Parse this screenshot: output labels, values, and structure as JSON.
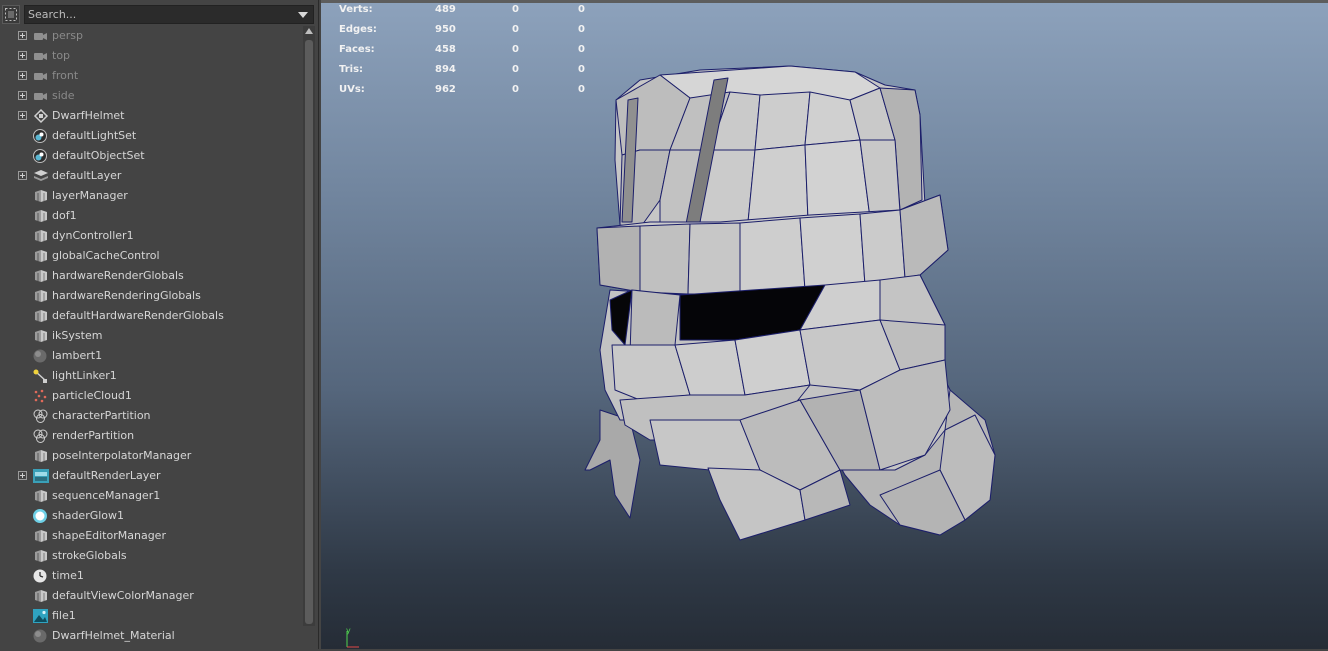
{
  "outliner": {
    "search_placeholder": "Search...",
    "items": [
      {
        "label": "persp",
        "icon": "camera-icon",
        "expandable": true,
        "dim": true
      },
      {
        "label": "top",
        "icon": "camera-icon",
        "expandable": true,
        "dim": true
      },
      {
        "label": "front",
        "icon": "camera-icon",
        "expandable": true,
        "dim": true
      },
      {
        "label": "side",
        "icon": "camera-icon",
        "expandable": true,
        "dim": true
      },
      {
        "label": "DwarfHelmet",
        "icon": "group-icon",
        "expandable": true,
        "dim": false
      },
      {
        "label": "defaultLightSet",
        "icon": "set-icon",
        "expandable": false,
        "dim": false
      },
      {
        "label": "defaultObjectSet",
        "icon": "set-icon",
        "expandable": false,
        "dim": false
      },
      {
        "label": "defaultLayer",
        "icon": "layer-icon",
        "expandable": true,
        "dim": false
      },
      {
        "label": "layerManager",
        "icon": "node-icon",
        "expandable": false,
        "dim": false
      },
      {
        "label": "dof1",
        "icon": "node-icon",
        "expandable": false,
        "dim": false
      },
      {
        "label": "dynController1",
        "icon": "node-icon",
        "expandable": false,
        "dim": false
      },
      {
        "label": "globalCacheControl",
        "icon": "node-icon",
        "expandable": false,
        "dim": false
      },
      {
        "label": "hardwareRenderGlobals",
        "icon": "node-icon",
        "expandable": false,
        "dim": false
      },
      {
        "label": "hardwareRenderingGlobals",
        "icon": "node-icon",
        "expandable": false,
        "dim": false
      },
      {
        "label": "defaultHardwareRenderGlobals",
        "icon": "node-icon",
        "expandable": false,
        "dim": false
      },
      {
        "label": "ikSystem",
        "icon": "node-icon",
        "expandable": false,
        "dim": false
      },
      {
        "label": "lambert1",
        "icon": "material-sphere-icon",
        "expandable": false,
        "dim": false
      },
      {
        "label": "lightLinker1",
        "icon": "light-linker-icon",
        "expandable": false,
        "dim": false
      },
      {
        "label": "particleCloud1",
        "icon": "particle-icon",
        "expandable": false,
        "dim": false
      },
      {
        "label": "characterPartition",
        "icon": "partition-icon",
        "expandable": false,
        "dim": false
      },
      {
        "label": "renderPartition",
        "icon": "partition-icon",
        "expandable": false,
        "dim": false
      },
      {
        "label": "poseInterpolatorManager",
        "icon": "node-icon",
        "expandable": false,
        "dim": false
      },
      {
        "label": "defaultRenderLayer",
        "icon": "render-layer-icon",
        "expandable": true,
        "dim": false
      },
      {
        "label": "sequenceManager1",
        "icon": "node-icon",
        "expandable": false,
        "dim": false
      },
      {
        "label": "shaderGlow1",
        "icon": "shader-glow-icon",
        "expandable": false,
        "dim": false
      },
      {
        "label": "shapeEditorManager",
        "icon": "node-icon",
        "expandable": false,
        "dim": false
      },
      {
        "label": "strokeGlobals",
        "icon": "node-icon",
        "expandable": false,
        "dim": false
      },
      {
        "label": "time1",
        "icon": "clock-icon",
        "expandable": false,
        "dim": false
      },
      {
        "label": "defaultViewColorManager",
        "icon": "node-icon",
        "expandable": false,
        "dim": false
      },
      {
        "label": "file1",
        "icon": "image-file-icon",
        "expandable": false,
        "dim": false
      },
      {
        "label": "DwarfHelmet_Material",
        "icon": "material-sphere-icon",
        "expandable": false,
        "dim": false
      }
    ]
  },
  "viewport": {
    "hud": [
      {
        "label": "Verts:",
        "v1": "489",
        "v2": "0",
        "v3": "0"
      },
      {
        "label": "Edges:",
        "v1": "950",
        "v2": "0",
        "v3": "0"
      },
      {
        "label": "Faces:",
        "v1": "458",
        "v2": "0",
        "v3": "0"
      },
      {
        "label": "Tris:",
        "v1": "894",
        "v2": "0",
        "v3": "0"
      },
      {
        "label": "UVs:",
        "v1": "962",
        "v2": "0",
        "v3": "0"
      }
    ],
    "axis_label": "y",
    "colors": {
      "mesh_fill": "#c4c4c4",
      "mesh_wire": "#1c1f6a",
      "gradient_top": "#8da2bc",
      "gradient_bottom": "#252c36"
    }
  }
}
